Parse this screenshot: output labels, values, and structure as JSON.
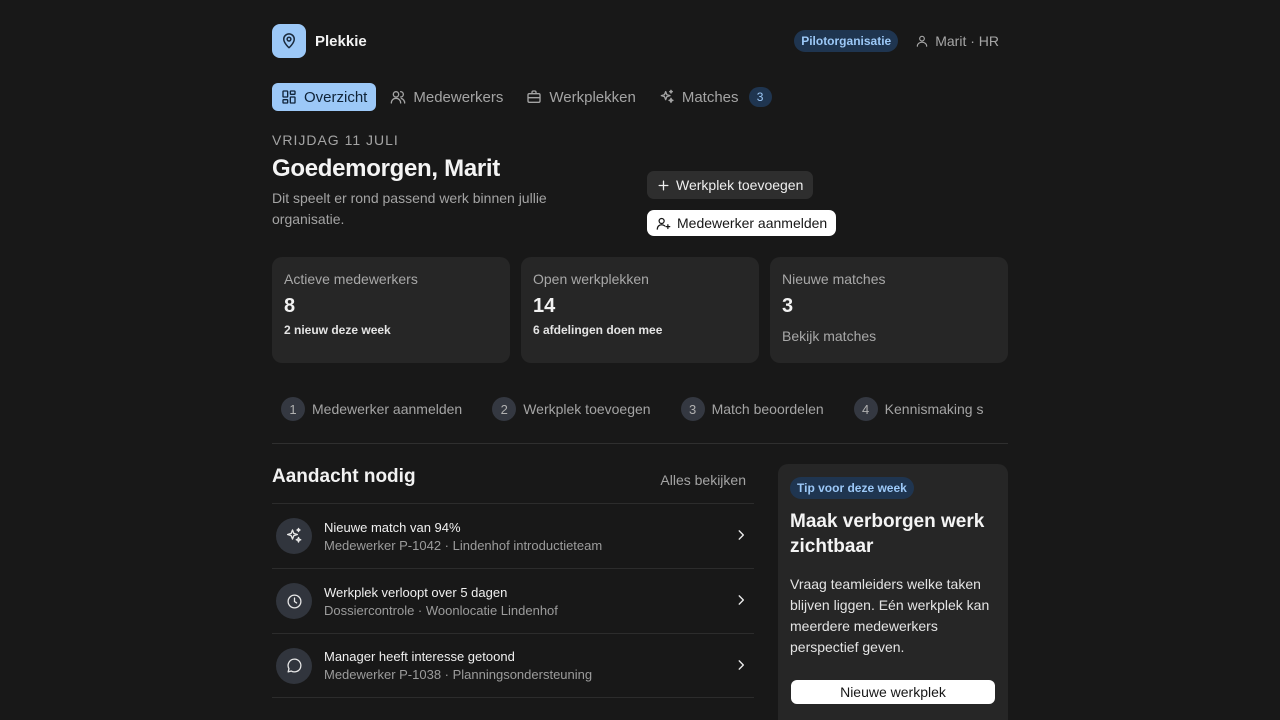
{
  "brand": {
    "name": "Plekkie",
    "logo_icon": "map-pin-icon",
    "color": "#9cc8f7"
  },
  "header": {
    "org_badge": "Pilotorganisatie",
    "user_label": "Marit · HR",
    "user_icon": "user-icon"
  },
  "tabs": [
    {
      "label": "Overzicht",
      "icon": "dashboard-icon",
      "active": true
    },
    {
      "label": "Medewerkers",
      "icon": "users-icon",
      "active": false
    },
    {
      "label": "Werkplekken",
      "icon": "briefcase-icon",
      "active": false
    },
    {
      "label": "Matches",
      "icon": "sparkles-icon",
      "active": false,
      "count": "3"
    }
  ],
  "hero": {
    "date": "VRIJDAG 11 JULI",
    "greeting": "Goedemorgen, Marit",
    "intro": "Dit speelt er rond passend werk binnen jullie organisatie.",
    "add_workplace": "Werkplek toevoegen",
    "register_employee": "Medewerker aanmelden"
  },
  "stats": [
    {
      "label": "Actieve medewerkers",
      "value": "8",
      "sub": "2 nieuw deze week"
    },
    {
      "label": "Open werkplekken",
      "value": "14",
      "sub": "6 afdelingen doen mee"
    },
    {
      "label": "Nieuwe matches",
      "value": "3",
      "link": "Bekijk matches"
    }
  ],
  "steps": [
    {
      "num": "1",
      "label": "Medewerker aanmelden"
    },
    {
      "num": "2",
      "label": "Werkplek toevoegen"
    },
    {
      "num": "3",
      "label": "Match beoordelen"
    },
    {
      "num": "4",
      "label": "Kennismaking s"
    }
  ],
  "attention": {
    "title": "Aandacht nodig",
    "view_all": "Alles bekijken",
    "items": [
      {
        "title": "Nieuwe match van 94%",
        "sub": "Medewerker P-1042 · Lindenhof introductieteam",
        "icon": "sparkles-icon"
      },
      {
        "title": "Werkplek verloopt over 5 dagen",
        "sub": "Dossiercontrole · Woonlocatie Lindenhof",
        "icon": "clock-icon"
      },
      {
        "title": "Manager heeft interesse getoond",
        "sub": "Medewerker P-1038 · Planningsondersteuning",
        "icon": "chat-bubble-icon"
      }
    ]
  },
  "tip": {
    "badge": "Tip voor deze week",
    "title": "Maak verborgen werk zichtbaar",
    "body": "Vraag teamleiders welke taken blijven liggen. Eén werkplek kan meerdere medewerkers perspectief geven.",
    "button": "Nieuwe werkplek"
  },
  "colors": {
    "background": "#181818",
    "card": "#262626",
    "accent": "#9cc8f7",
    "accent_dark": "#1f3550"
  }
}
